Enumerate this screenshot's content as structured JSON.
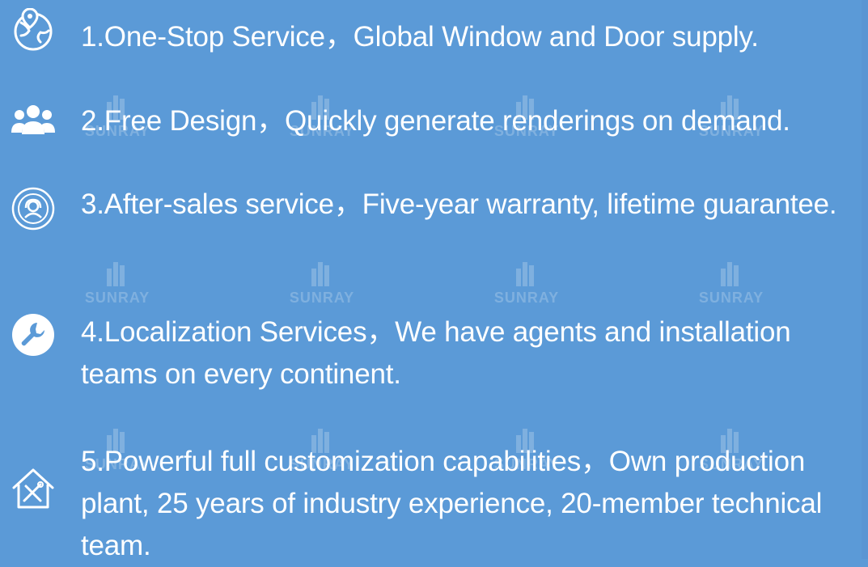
{
  "watermark": {
    "brand": "SUNRAY"
  },
  "items": [
    {
      "icon": "globe-location-icon",
      "text": "1.One-Stop Service，Global Window and Door supply."
    },
    {
      "icon": "team-icon",
      "text": "2.Free Design，Quickly generate renderings on demand."
    },
    {
      "icon": "support-agent-icon",
      "text": "3.After-sales service，Five-year warranty, lifetime guarantee."
    },
    {
      "icon": "wrench-icon",
      "text": "4.Localization Services，We have agents and installation teams on every continent."
    },
    {
      "icon": "house-tools-icon",
      "text": "5.Powerful full customization capabilities，Own production plant, 25 years of industry experience, 20-member technical team."
    }
  ],
  "colors": {
    "background": "#5b9ad7",
    "text": "#ffffff"
  }
}
